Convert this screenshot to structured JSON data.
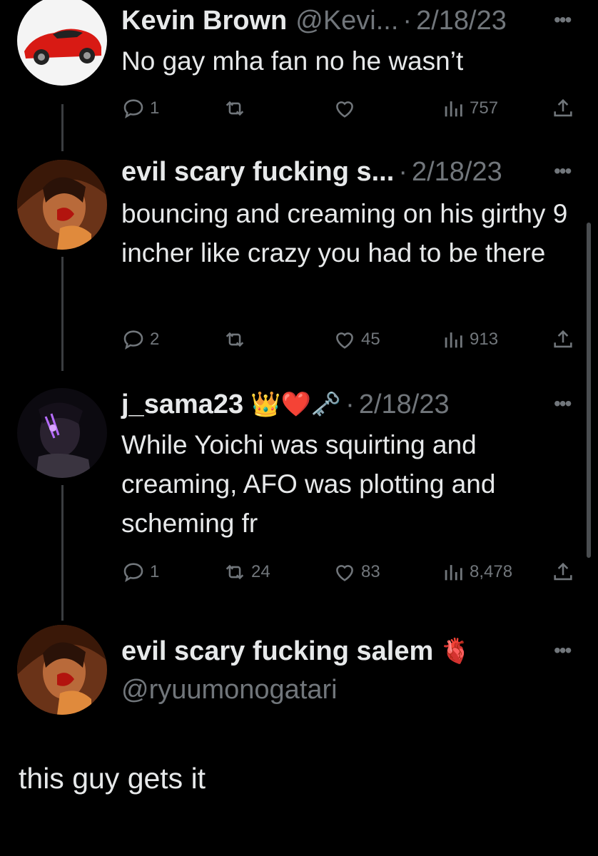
{
  "tweets": [
    {
      "name": "Kevin Brown",
      "handle": "@Kevi...",
      "date": "2/18/23",
      "text": "No gay mha fan no he wasn’t",
      "replies": "1",
      "retweets": "",
      "likes": "",
      "views": "757"
    },
    {
      "name": "evil scary fucking s...",
      "date": "2/18/23",
      "text": "bouncing and creaming on his girthy 9 incher like crazy you had to be there",
      "replies": "2",
      "retweets": "",
      "likes": "45",
      "views": "913"
    },
    {
      "name": "j_sama23",
      "emojis": "👑❤️🗝️",
      "date": "2/18/23",
      "text": "While Yoichi was squirting and creaming, AFO was plotting and scheming fr",
      "replies": "1",
      "retweets": "24",
      "likes": "83",
      "views": "8,478"
    },
    {
      "name": "evil scary fucking salem",
      "emoji": "🫀",
      "handle": "@ryuumonogatari"
    }
  ],
  "caption": "this guy gets it",
  "more_glyph": "•••",
  "dot": "·",
  "colors": {
    "background": "#000000",
    "text": "#e7e9ea",
    "muted": "#71767b",
    "thread_line": "#3a3d40"
  }
}
